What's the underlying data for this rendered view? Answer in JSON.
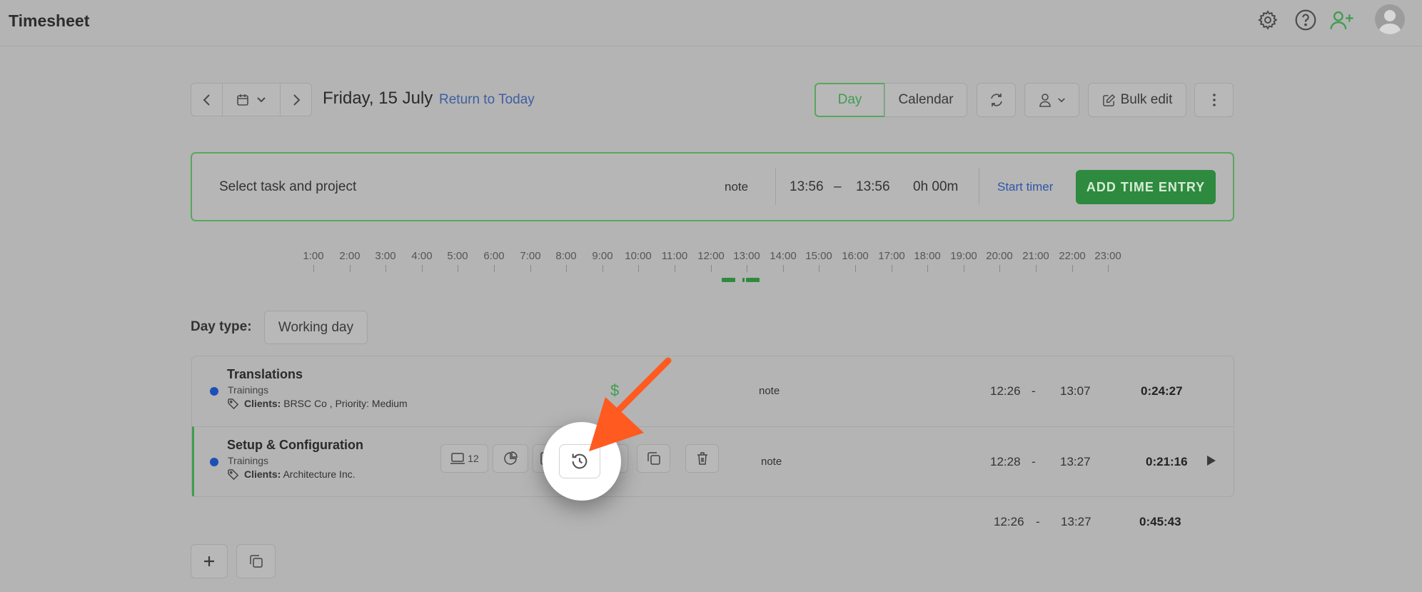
{
  "app": {
    "title": "Timesheet"
  },
  "header_icons": [
    "gear-icon",
    "help-icon",
    "add-user-icon",
    "avatar"
  ],
  "date_nav": {
    "date": "Friday, 15 July",
    "return_link": "Return to Today"
  },
  "view_toggle": {
    "day": "Day",
    "calendar": "Calendar",
    "active": "Day"
  },
  "toolbar": {
    "bulk_edit": "Bulk edit"
  },
  "entry": {
    "task_placeholder": "Select task and project",
    "note": "note",
    "start": "13:56",
    "separator": "–",
    "end": "13:56",
    "duration": "0h 00m",
    "start_timer": "Start timer",
    "add_button": "ADD TIME ENTRY"
  },
  "timeline": {
    "hours": [
      "1:00",
      "2:00",
      "3:00",
      "4:00",
      "5:00",
      "6:00",
      "7:00",
      "8:00",
      "9:00",
      "10:00",
      "11:00",
      "12:00",
      "13:00",
      "14:00",
      "15:00",
      "16:00",
      "17:00",
      "18:00",
      "19:00",
      "20:00",
      "21:00",
      "22:00",
      "23:00"
    ]
  },
  "day_type": {
    "label": "Day type:",
    "value": "Working day"
  },
  "entries": [
    {
      "title": "Translations",
      "project": "Trainings",
      "tags_prefix": "Clients:",
      "tags_text": "BRSC Co , Priority: Medium",
      "billable_symbol": "$",
      "note": "note",
      "start": "12:26",
      "separator": "-",
      "end": "13:07",
      "duration": "0:24:27"
    },
    {
      "title": "Setup & Configuration",
      "project": "Trainings",
      "tags_prefix": "Clients:",
      "tags_text": "Architecture Inc.",
      "activity_count": "12",
      "note": "note",
      "start": "12:28",
      "separator": "-",
      "end": "13:27",
      "duration": "0:21:16"
    }
  ],
  "totals": {
    "start": "12:26",
    "separator": "-",
    "end": "13:27",
    "duration": "0:45:43"
  },
  "colors": {
    "accent_green": "#2d8a3e",
    "link_blue": "#3e5fa0",
    "callout_arrow": "#ff5a1f",
    "project_dot": "#1d4fb8"
  }
}
